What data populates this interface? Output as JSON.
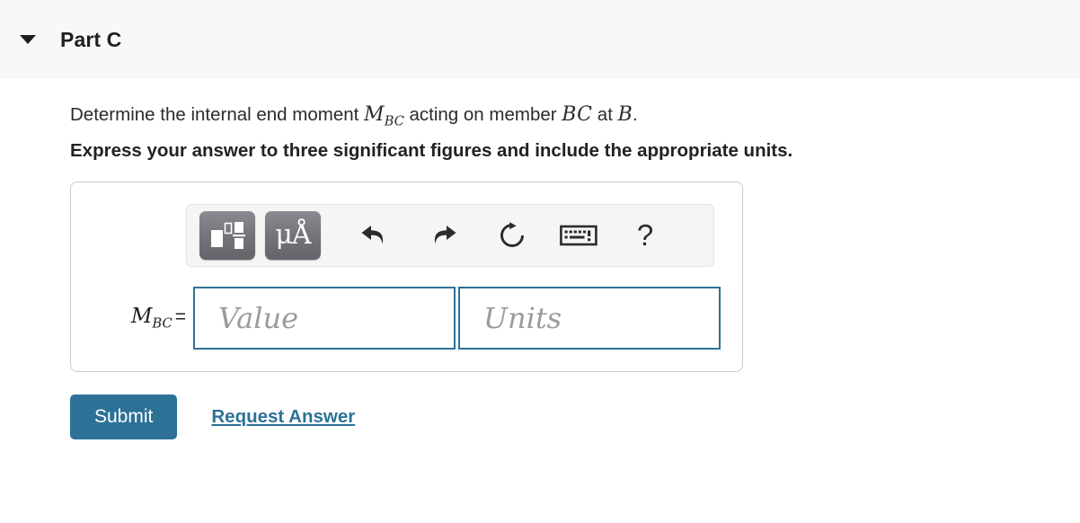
{
  "header": {
    "title": "Part C",
    "disclosure_icon": "triangle-down-icon"
  },
  "question": {
    "prompt_pre": "Determine the internal end moment ",
    "prompt_var1": "M",
    "prompt_var1_sub": "BC",
    "prompt_mid": " acting on member ",
    "prompt_var2": "BC",
    "prompt_mid2": " at ",
    "prompt_var3": "B",
    "prompt_end": ".",
    "instruction": "Express your answer to three significant figures and include the appropriate units."
  },
  "toolbar": {
    "items": [
      {
        "name": "math-template-button",
        "icon": "math-template-icon",
        "label": ""
      },
      {
        "name": "units-button",
        "icon": "micro-angstrom-icon",
        "label": "μÅ"
      },
      {
        "name": "undo-button",
        "icon": "undo-arrow-icon",
        "label": ""
      },
      {
        "name": "redo-button",
        "icon": "redo-arrow-icon",
        "label": ""
      },
      {
        "name": "reset-button",
        "icon": "reset-circular-arrow-icon",
        "label": ""
      },
      {
        "name": "keyboard-button",
        "icon": "keyboard-icon",
        "label": ""
      },
      {
        "name": "help-button",
        "icon": "question-mark-icon",
        "label": "?"
      }
    ]
  },
  "answer": {
    "label_var": "M",
    "label_sub": "BC",
    "equals": "=",
    "value_placeholder": "Value",
    "units_placeholder": "Units",
    "value": "",
    "units": ""
  },
  "actions": {
    "submit_label": "Submit",
    "request_answer_label": "Request Answer"
  },
  "colors": {
    "accent": "#2d7296",
    "header_bg": "#f8f8f8",
    "toolbar_bg": "#f5f5f5",
    "button_gray": "#76767c",
    "placeholder": "#9b9b9b"
  }
}
